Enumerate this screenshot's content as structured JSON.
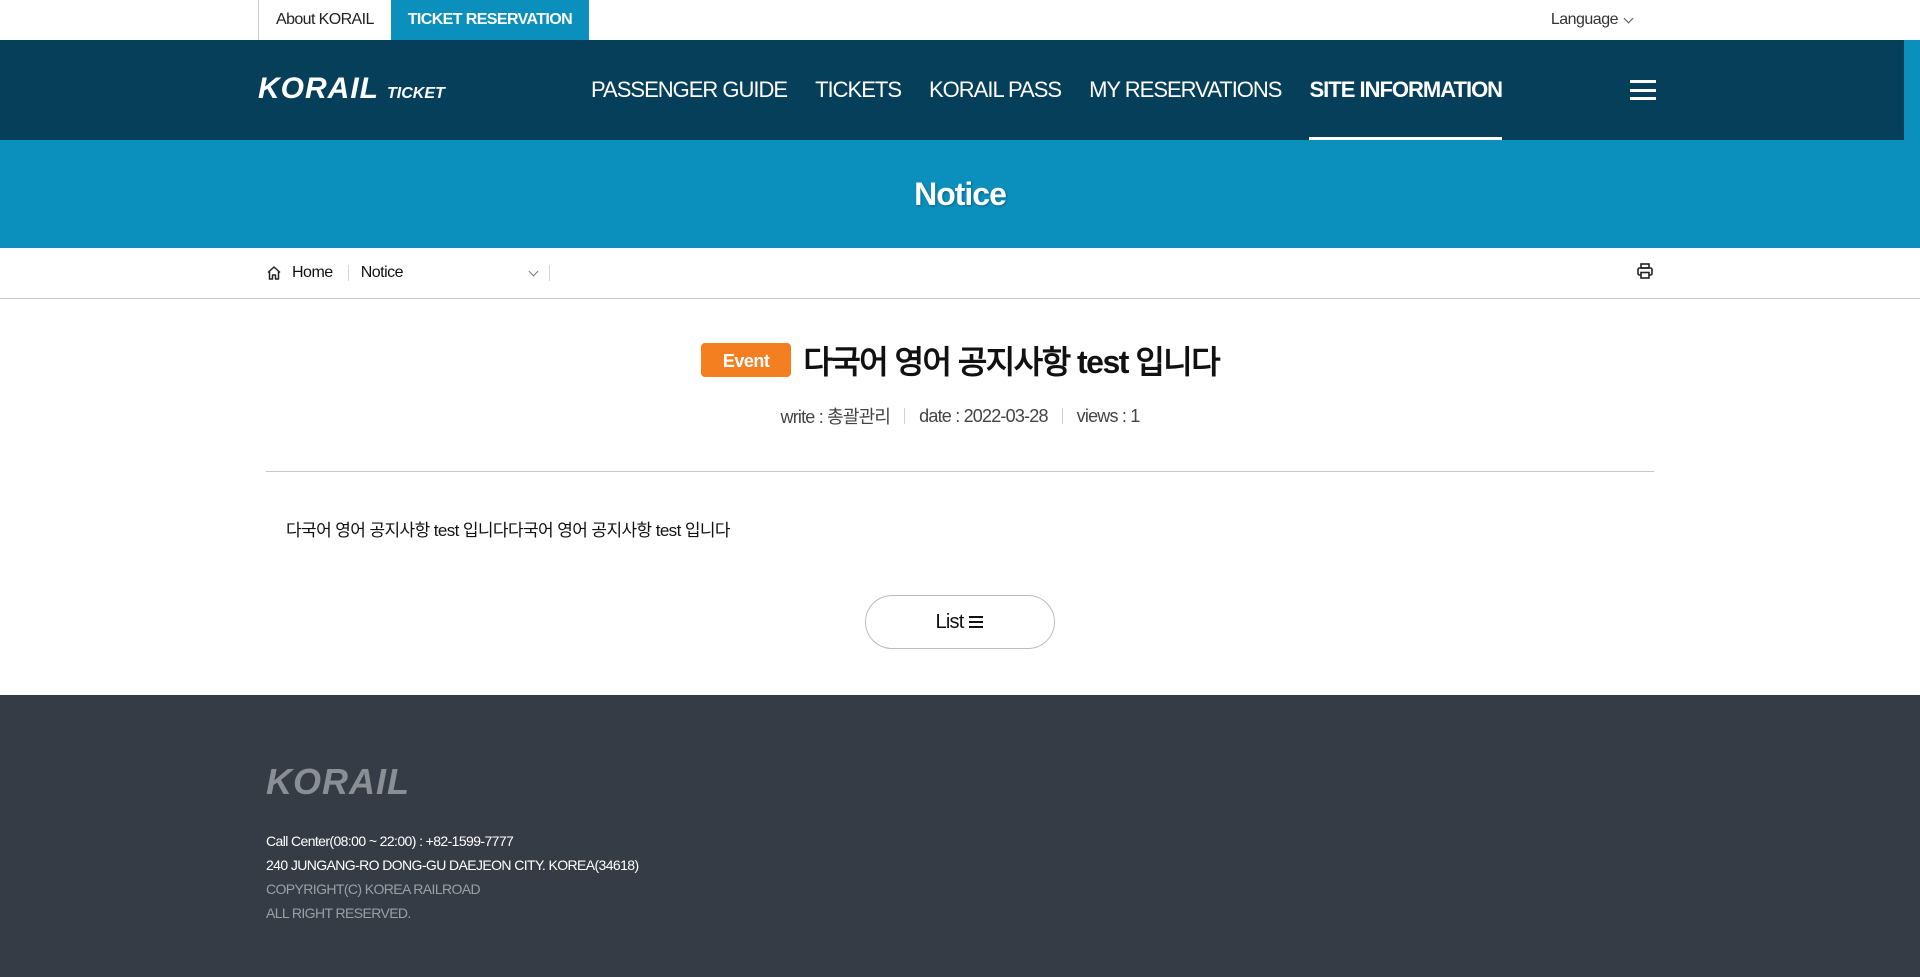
{
  "topbar": {
    "about_label": "About KORAIL",
    "ticket_label": "TICKET RESERVATION",
    "language_label": "Language"
  },
  "header": {
    "logo_text": "KORAIL",
    "logo_sub": "TICKET",
    "menu": [
      {
        "label": "PASSENGER GUIDE"
      },
      {
        "label": "TICKETS"
      },
      {
        "label": "KORAIL PASS"
      },
      {
        "label": "MY RESERVATIONS"
      },
      {
        "label": "SITE INFORMATION"
      }
    ],
    "active_menu": "SITE INFORMATION"
  },
  "banner": {
    "title": "Notice"
  },
  "breadcrumb": {
    "home_label": "Home",
    "current_label": "Notice"
  },
  "article": {
    "badge": "Event",
    "title": "다국어 영어 공지사항 test 입니다",
    "writer": "write : 총괄관리",
    "date": "date : 2022-03-28",
    "views": "views : 1",
    "body": "다국어 영어 공지사항 test 입니다다국어 영어 공지사항 test 입니다",
    "list_button": "List"
  },
  "footer": {
    "logo_text": "KORAIL",
    "call_center": "Call Center(08:00 ~ 22:00) : +82-1599-7777",
    "address": "240 JUNGANG-RO DONG-GU DAEJEON CITY. KOREA(34618)",
    "copyright": "COPYRIGHT(C) KOREA RAILROAD",
    "rights": "ALL RIGHT RESERVED."
  },
  "colors": {
    "nav_bg": "#063f5a",
    "accent_blue": "#0b8fbd",
    "badge_orange": "#f47f20",
    "footer_bg": "#353c45"
  },
  "icons": [
    "home-icon",
    "chevron-down-icon",
    "print-icon",
    "hamburger-menu-icon",
    "list-icon"
  ]
}
